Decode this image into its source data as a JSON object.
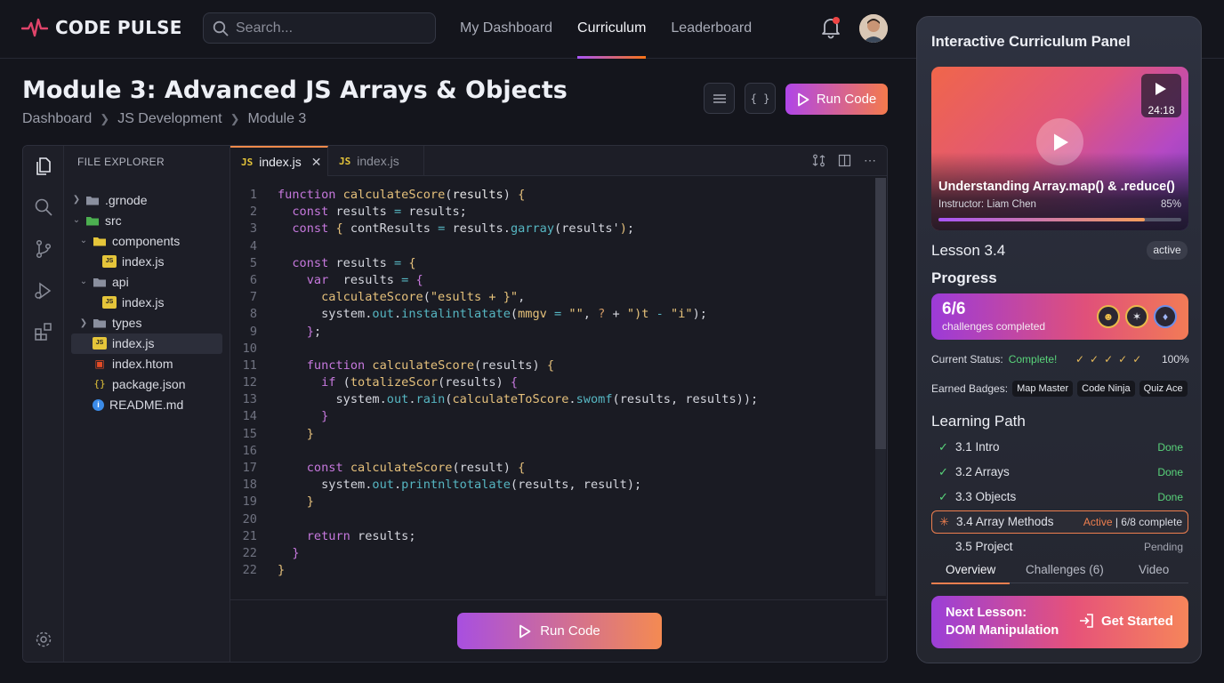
{
  "app": {
    "name": "CODE PULSE"
  },
  "search": {
    "placeholder": "Search..."
  },
  "nav": {
    "items": [
      "My Dashboard",
      "Curriculum",
      "Leaderboard"
    ],
    "active": "Curriculum"
  },
  "page": {
    "title": "Module 3: Advanced JS Arrays & Objects",
    "breadcrumb": [
      "Dashboard",
      "JS Development",
      "Module 3"
    ]
  },
  "toolbar": {
    "run_label": "Run Code"
  },
  "explorer": {
    "title": "FILE EXPLORER",
    "tree": [
      {
        "label": ".grnode",
        "type": "folder",
        "expanded": false
      },
      {
        "label": "src",
        "type": "folder",
        "expanded": true
      },
      {
        "label": "components",
        "type": "folder",
        "expanded": true
      },
      {
        "label": "index.js",
        "type": "js"
      },
      {
        "label": "api",
        "type": "folder",
        "expanded": true
      },
      {
        "label": "index.js",
        "type": "js"
      },
      {
        "label": "types",
        "type": "folder",
        "expanded": false
      },
      {
        "label": "index.js",
        "type": "js",
        "selected": true
      },
      {
        "label": "index.htom",
        "type": "html"
      },
      {
        "label": "package.json",
        "type": "json"
      },
      {
        "label": "README.md",
        "type": "info"
      }
    ]
  },
  "tabs": [
    {
      "icon": "JS",
      "label": "index.js",
      "active": true
    },
    {
      "icon": "JS",
      "label": "index.js",
      "active": false
    }
  ],
  "code": {
    "line_numbers": [
      "1",
      "2",
      "3",
      "4",
      "5",
      "6",
      "7",
      "8",
      "9",
      "10",
      "11",
      "12",
      "13",
      "14",
      "15",
      "16",
      "17",
      "18",
      "19",
      "20",
      "21",
      "22",
      "22"
    ]
  },
  "bottom": {
    "run_label": "Run Code"
  },
  "panel": {
    "title": "Interactive Curriculum Panel",
    "video": {
      "duration": "24:18",
      "title": "Understanding Array.map() & .reduce()",
      "instructor": "Instructor: Liam Chen",
      "progress_label": "85%",
      "progress": 0.85
    },
    "lesson": "Lesson 3.4",
    "lesson_badge": "active",
    "progress_heading": "Progress",
    "challenges": {
      "count": "6/6",
      "label": "challenges completed"
    },
    "status": {
      "label": "Current Status:",
      "value": "Complete!",
      "checks": "✓✓✓✓✓",
      "percent": "100%"
    },
    "badges": {
      "label": "Earned Badges:",
      "items": [
        "Map Master",
        "Code Ninja",
        "Quiz Ace"
      ]
    },
    "learning_path": {
      "heading": "Learning Path",
      "items": [
        {
          "name": "3.1 Intro",
          "status": "Done"
        },
        {
          "name": "3.2 Arrays",
          "status": "Done"
        },
        {
          "name": "3.3 Objects",
          "status": "Done"
        },
        {
          "name": "3.4 Array Methods",
          "status": "Active",
          "extra": " | 6/8 complete"
        },
        {
          "name": "3.5 Project",
          "status": "Pending"
        }
      ]
    },
    "tabs": [
      "Overview",
      "Challenges (6)",
      "Video"
    ],
    "next": {
      "line1": "Next Lesson:",
      "line2": "DOM Manipulation",
      "button": "Get Started"
    }
  },
  "colors": {
    "accent_purple": "#a855f7",
    "accent_orange": "#f97316",
    "success": "#59d37a"
  }
}
